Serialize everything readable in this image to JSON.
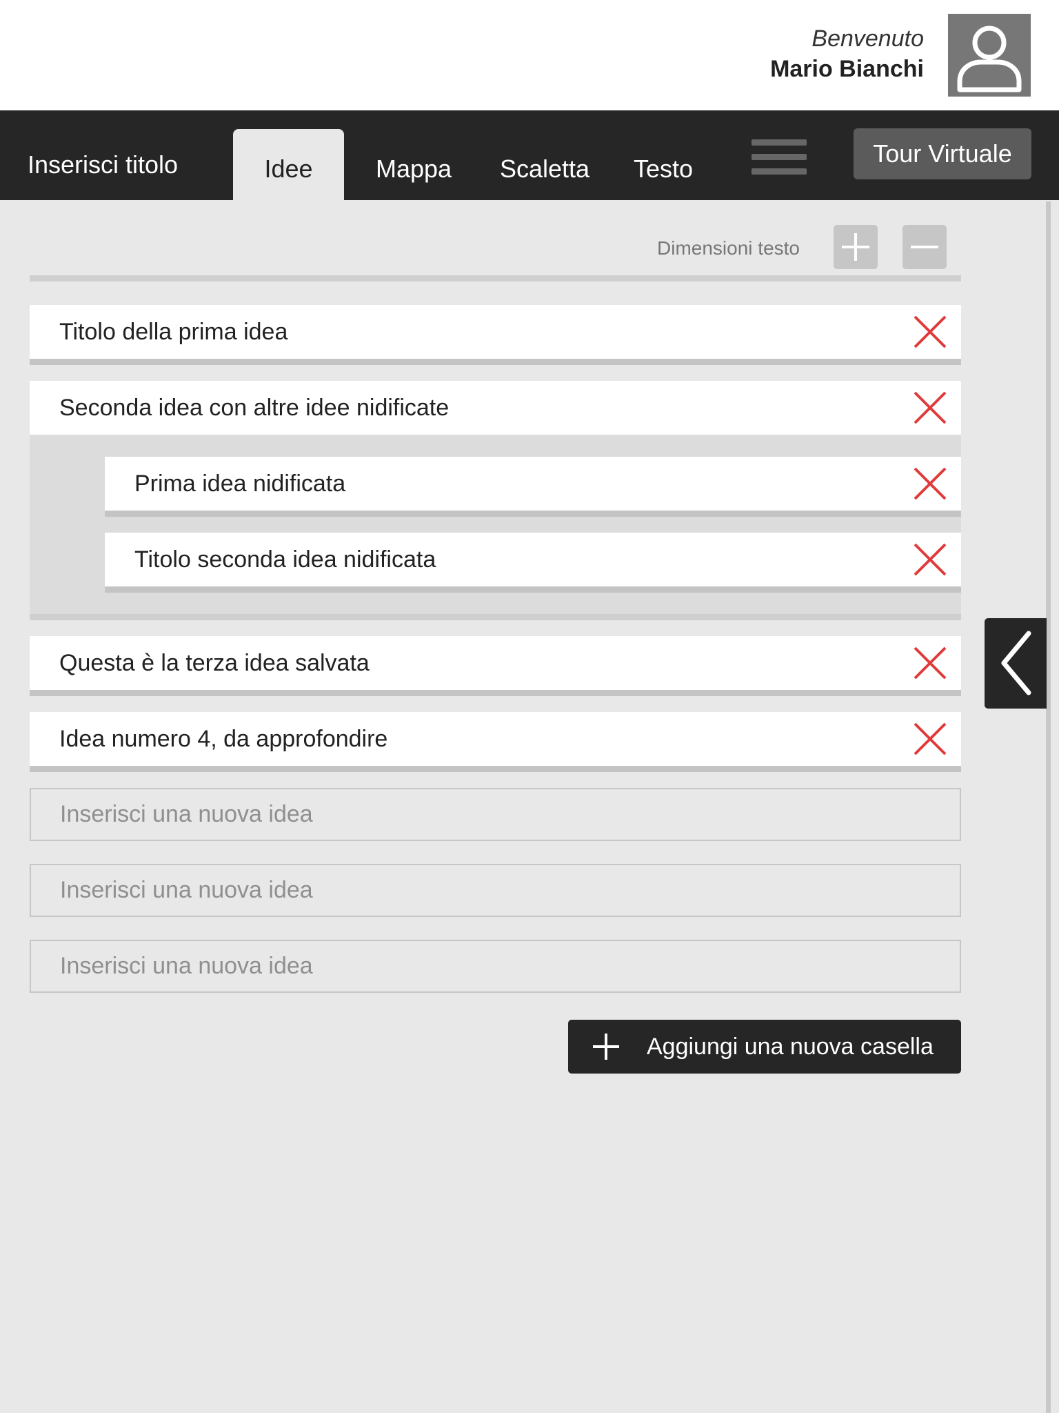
{
  "header": {
    "welcome_label": "Benvenuto",
    "user_name": "Mario Bianchi",
    "avatar_icon": "user-icon"
  },
  "navbar": {
    "title": "Inserisci titolo",
    "tabs": [
      {
        "label": "Idee",
        "active": true
      },
      {
        "label": "Mappa",
        "active": false
      },
      {
        "label": "Scaletta",
        "active": false
      },
      {
        "label": "Testo",
        "active": false
      }
    ],
    "menu_icon": "hamburger-menu-icon",
    "tour_button": "Tour Virtuale"
  },
  "toolbar": {
    "text_size_label": "Dimensioni testo",
    "increase_icon": "plus-icon",
    "decrease_icon": "minus-icon"
  },
  "ideas": [
    {
      "title": "Titolo della prima idea"
    },
    {
      "title": "Seconda idea con altre idee nidificate",
      "children": [
        {
          "title": "Prima idea nidificata"
        },
        {
          "title": "Titolo seconda idea nidificata"
        }
      ]
    },
    {
      "title": "Questa è la terza idea salvata"
    },
    {
      "title": "Idea numero 4, da approfondire"
    }
  ],
  "new_idea_placeholders": [
    "Inserisci una nuova idea",
    "Inserisci una nuova idea",
    "Inserisci una nuova idea"
  ],
  "add_button": "Aggiungi una nuova casella",
  "side_toggle_icon": "chevron-left-icon",
  "colors": {
    "dark": "#262626",
    "background": "#e8e8e8",
    "delete": "#e03a3a"
  }
}
